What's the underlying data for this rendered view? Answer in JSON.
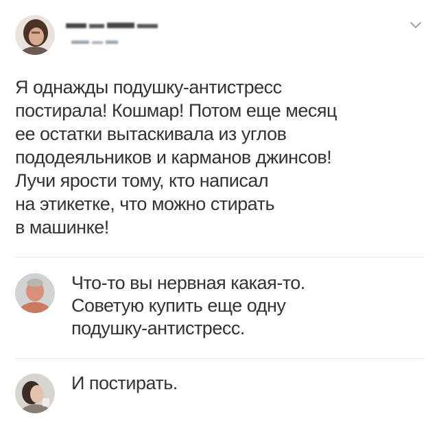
{
  "post": {
    "author_name": "",
    "author_handle": "",
    "lines": [
      "Я однажды подушку-антистресс",
      "постирала! Кошмар! Потом еще месяц",
      "ее остатки вытаскивала из углов",
      "пододеяльников и карманов джинсов!",
      "Лучи ярости тому, кто написал",
      "на этикетке, что можно стирать",
      "в машинке!"
    ]
  },
  "replies": [
    {
      "lines": [
        "Что-то вы нервная какая-то.",
        "Советую купить еще одну",
        "подушку-антистресс."
      ]
    },
    {
      "lines": [
        "И постирать."
      ]
    }
  ],
  "icons": {
    "more_menu": "chevron-down-icon"
  },
  "colors": {
    "text": "#333333",
    "divider": "#e3e3e3",
    "chevron": "#8899a6",
    "background": "#ffffff"
  }
}
